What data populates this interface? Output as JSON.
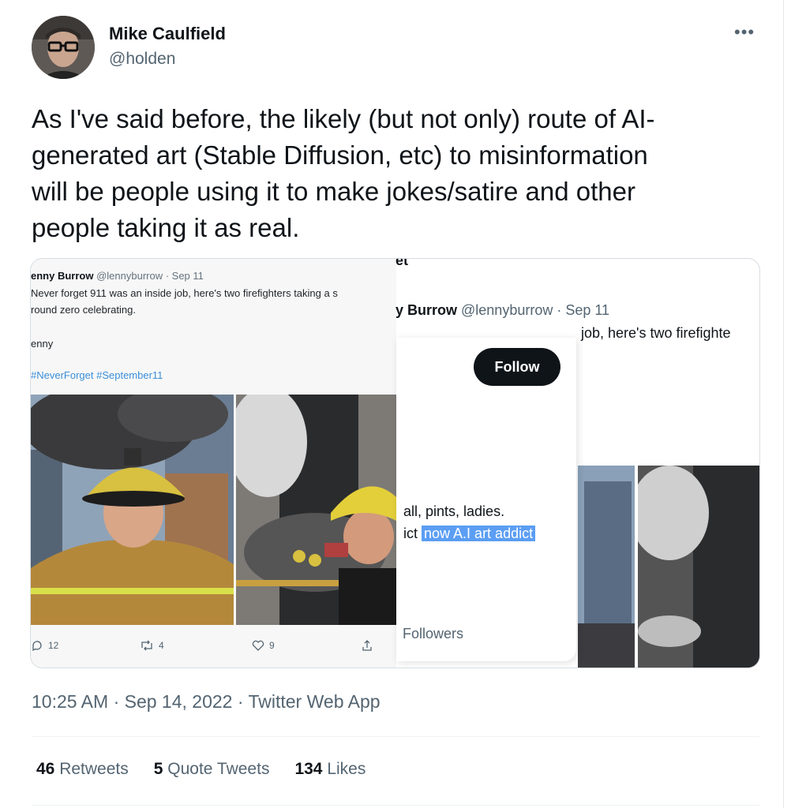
{
  "author": {
    "name": "Mike Caulfield",
    "handle": "@holden",
    "more_icon": "•••"
  },
  "tweet": {
    "text": "As I've said before, the likely (but not only) route of AI-\ngenerated art  (Stable Diffusion, etc) to misinformation\nwill be people using it to make jokes/satire and other\npeople taking it as real."
  },
  "embedded": {
    "left_tweet": {
      "author_name": "enny Burrow",
      "author_meta": " @lennyburrow · Sep 11",
      "line1": "Never forget 911 was an inside job, here's two firefighters taking a s",
      "line2": "round zero celebrating.",
      "signoff": "enny",
      "hashtags": "#NeverForget #September11",
      "replies": "12",
      "retweets": "4",
      "likes": "9"
    },
    "right_tweet": {
      "top_fragment": "et",
      "author_name": "y Burrow",
      "author_meta": " @lennyburrow · Sep 11",
      "line2": "job, here's two firefighte"
    },
    "hover_card": {
      "follow_label": "Follow",
      "bio_line1": "all, pints, ladies.",
      "bio_line2_prefix": "ict ",
      "bio_line2_highlight": "now A.I art addict",
      "followers_label": "Followers"
    }
  },
  "footer": {
    "timestamp": "10:25 AM · Sep 14, 2022 · Twitter Web App",
    "retweets_count": "46",
    "retweets_label": " Retweets",
    "quotes_count": "5",
    "quotes_label": " Quote Tweets",
    "likes_count": "134",
    "likes_label": " Likes"
  }
}
